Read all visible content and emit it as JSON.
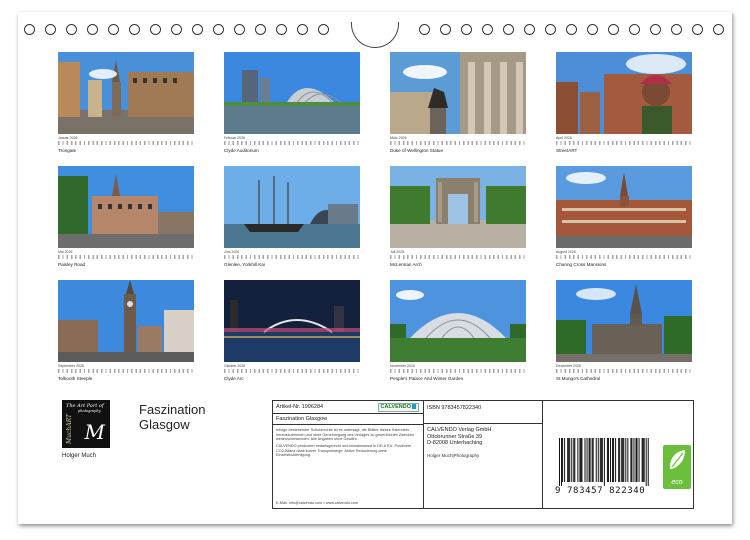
{
  "calendar": {
    "months": [
      {
        "label": "Januar 2026",
        "caption": "Trongate",
        "scene": "street"
      },
      {
        "label": "Februar 2026",
        "caption": "Clyde Auditorium",
        "scene": "auditorium"
      },
      {
        "label": "März 2026",
        "caption": "Duke of Wellington Statue",
        "scene": "statue"
      },
      {
        "label": "April 2026",
        "caption": "StreetART",
        "scene": "mural"
      },
      {
        "label": "Mai 2026",
        "caption": "Paisley Road",
        "scene": "building"
      },
      {
        "label": "Juni 2026",
        "caption": "Glenlee, Yorkhill Kai",
        "scene": "ship"
      },
      {
        "label": "Juli 2026",
        "caption": "McLennan Arch",
        "scene": "arch"
      },
      {
        "label": "August 2026",
        "caption": "Charing Cross Mansions",
        "scene": "mansion"
      },
      {
        "label": "September 2026",
        "caption": "Tolbooth Steeple",
        "scene": "steeple"
      },
      {
        "label": "Oktober 2026",
        "caption": "Clyde Arc",
        "scene": "night"
      },
      {
        "label": "November 2026",
        "caption": "People's Palace And Winter Garden",
        "scene": "glasshouse"
      },
      {
        "label": "Dezember 2026",
        "caption": "St Mungo's Cathedral",
        "scene": "cathedral"
      }
    ]
  },
  "logo": {
    "line1": "The Art Part of",
    "line2": "photography",
    "side": "MuchART",
    "mark": "M"
  },
  "author": "Holger Much",
  "title": {
    "line1": "Faszination",
    "line2": "Glasgow"
  },
  "info": {
    "article_number": "Artikel-Nr. 1996284",
    "calvendo_logo": "CALVENDO",
    "product_title": "Faszination Glasgow",
    "legal_text": "Infolge bestehender Schutzrechte ist es untersagt, die Blätter dieses Kalenders herauszutrennen und ohne Genehmigung des Verlages zu gewerblichen Zwecken weiterzuverwenden. Alle Angaben ohne Gewähr.",
    "eco_text": "CALVENDO produziert bedarfsgerecht und klimabewusst in DE & EU. Positivere CO2-Bilanz dank kurzer Transportwege. Aktive Reduzierung dank Einzelstückfertigung.",
    "email": "E-Mail: info@calvendo.com • www.calvendo.com",
    "isbn": "ISBN 9783457822340",
    "publisher": [
      "CALVENDO Verlag GmbH",
      "Ottobrunner Straße 39",
      "D-82008 Unterhaching"
    ],
    "photographer": "Holger Much|Photography",
    "barcode_number": "9 783457 822340",
    "eco_badge": "eco"
  },
  "colors": {
    "eco_green": "#6cbf3a",
    "calvendo_green": "#1f7a2a",
    "sky": "#3f8ee0"
  }
}
